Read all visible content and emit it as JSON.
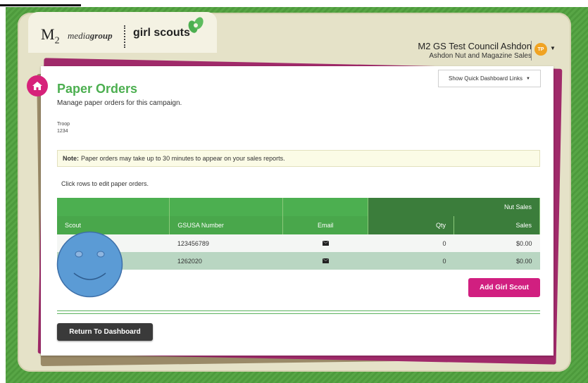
{
  "branding": {
    "m2": "M",
    "m2_sub": "2",
    "media_regular": "media",
    "media_bold": "group",
    "girl_scouts": "girl scouts"
  },
  "user": {
    "name": "M2 GS Test Council Ashdon",
    "campaign": "Ashdon Nut and Magazine Sales",
    "initials": "TP",
    "accent": "#f0a323"
  },
  "quick_links": {
    "label": "Show Quick Dashboard Links"
  },
  "page": {
    "title": "Paper Orders",
    "subtitle": "Manage paper orders for this campaign.",
    "troop_label": "Troop",
    "troop_value": "1234"
  },
  "note": {
    "prefix": "Note:",
    "text": "Paper orders may take up to 30 minutes to appear on your sales reports."
  },
  "hint": "Click rows to edit paper orders.",
  "table": {
    "group_header": "Nut Sales",
    "columns": [
      "Scout",
      "GSUSA Number",
      "Email",
      "Qty",
      "Sales"
    ],
    "rows": [
      {
        "scout": "",
        "gsusa": "123456789",
        "qty": "0",
        "sales": "$0.00"
      },
      {
        "scout": "",
        "gsusa": "1262020",
        "qty": "0",
        "sales": "$0.00"
      }
    ]
  },
  "buttons": {
    "add_scout": "Add Girl Scout",
    "return": "Return To Dashboard"
  },
  "colors": {
    "brand_green": "#4caf50",
    "dark_green": "#3b7d3b",
    "magenta": "#d11f80"
  }
}
